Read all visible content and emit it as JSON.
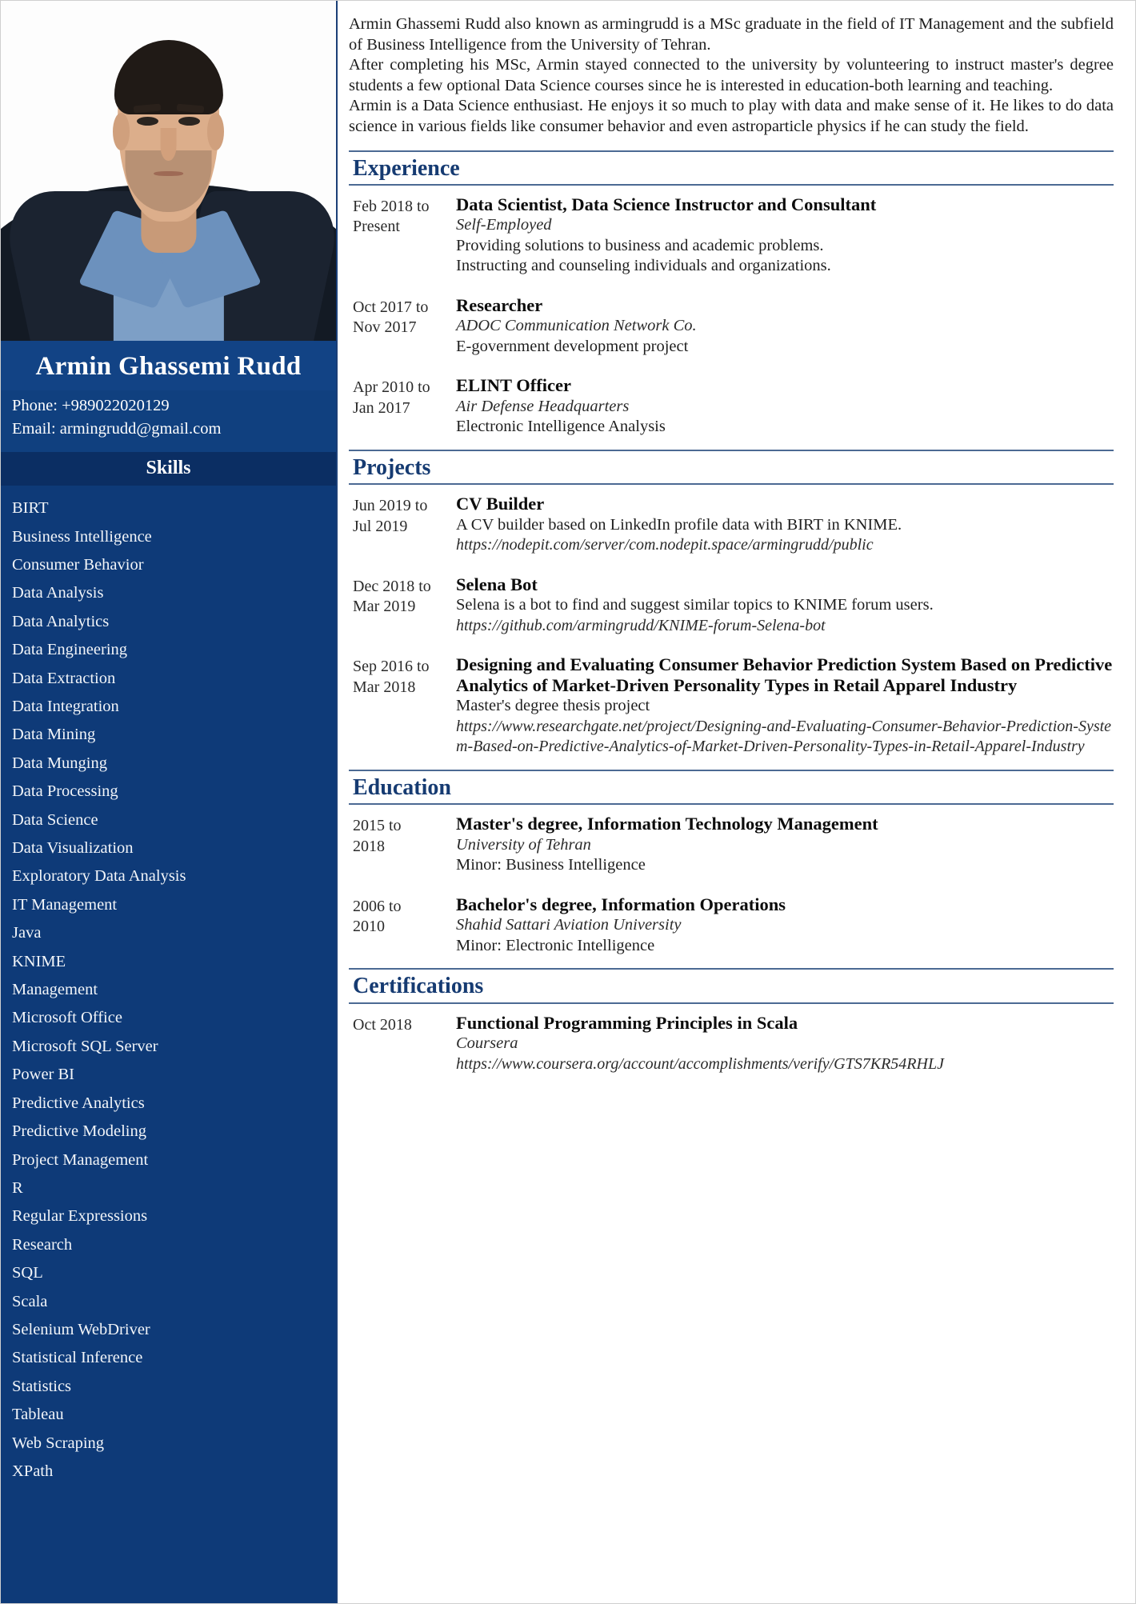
{
  "sidebar": {
    "photo_alt": "portrait-photo",
    "name": "Armin Ghassemi Rudd",
    "contact": {
      "phone": "Phone: +989022020129",
      "email": "Email: armingrudd@gmail.com"
    },
    "skills_heading": "Skills",
    "skills": [
      "BIRT",
      "Business Intelligence",
      "Consumer Behavior",
      "Data Analysis",
      "Data Analytics",
      "Data Engineering",
      "Data Extraction",
      "Data Integration",
      "Data Mining",
      "Data Munging",
      "Data Processing",
      "Data Science",
      "Data Visualization",
      "Exploratory Data Analysis",
      "IT Management",
      "Java",
      "KNIME",
      "Management",
      "Microsoft Office",
      "Microsoft SQL Server",
      "Power BI",
      "Predictive Analytics",
      "Predictive Modeling",
      "Project Management",
      "R",
      "Regular Expressions",
      "Research",
      "SQL",
      "Scala",
      "Selenium WebDriver",
      "Statistical Inference",
      "Statistics",
      "Tableau",
      "Web Scraping",
      "XPath"
    ]
  },
  "summary": {
    "paragraph_1": "Armin Ghassemi Rudd also known as armingrudd is a MSc graduate in the field of IT Management and the subfield of Business Intelligence from the University of Tehran.",
    "paragraph_2": "After completing his MSc, Armin stayed connected to the university by volunteering to instruct master's degree students a few optional Data Science courses since he is interested in education-both learning and teaching.",
    "paragraph_3": "Armin is a Data Science enthusiast. He enjoys it so much to play with data and make sense of it. He likes to do data science in various fields like consumer behavior and even astroparticle physics if he can study the field."
  },
  "sections": [
    {
      "id": "experience",
      "heading": "Experience",
      "entries": [
        {
          "date_from": "Feb 2018 to",
          "date_to": "Present",
          "title": "Data Scientist, Data Science Instructor and Consultant",
          "subtitle": "Self-Employed",
          "lines": [
            "Providing solutions to business and academic problems.",
            "Instructing and counseling individuals and organizations."
          ],
          "url": ""
        },
        {
          "date_from": "Oct 2017 to",
          "date_to": "Nov 2017",
          "title": "Researcher",
          "subtitle": "ADOC Communication Network Co.",
          "lines": [
            "E-government development project"
          ],
          "url": ""
        },
        {
          "date_from": "Apr 2010 to",
          "date_to": "Jan 2017",
          "title": "ELINT Officer",
          "subtitle": "Air Defense Headquarters",
          "lines": [
            "Electronic Intelligence Analysis"
          ],
          "url": ""
        }
      ]
    },
    {
      "id": "projects",
      "heading": "Projects",
      "entries": [
        {
          "date_from": "Jun 2019 to",
          "date_to": "Jul 2019",
          "title": "CV Builder",
          "subtitle": "",
          "lines": [
            "A CV builder based on LinkedIn profile data with BIRT in KNIME."
          ],
          "url": "https://nodepit.com/server/com.nodepit.space/armingrudd/public"
        },
        {
          "date_from": "Dec 2018 to",
          "date_to": "Mar 2019",
          "title": "Selena Bot",
          "subtitle": "",
          "lines": [
            "Selena is a bot to find and suggest similar topics to KNIME forum users."
          ],
          "url": "https://github.com/armingrudd/KNIME-forum-Selena-bot"
        },
        {
          "date_from": "Sep 2016 to",
          "date_to": "Mar 2018",
          "title": "Designing and Evaluating Consumer Behavior Prediction System Based on Predictive Analytics of Market-Driven Personality Types in Retail Apparel Industry",
          "subtitle": "",
          "lines": [
            "Master's degree thesis project"
          ],
          "url": "https://www.researchgate.net/project/Designing-and-Evaluating-Consumer-Behavior-Prediction-System-Based-on-Predictive-Analytics-of-Market-Driven-Personality-Types-in-Retail-Apparel-Industry"
        }
      ]
    },
    {
      "id": "education",
      "heading": "Education",
      "entries": [
        {
          "date_from": "2015 to",
          "date_to": "2018",
          "title": "Master's degree, Information Technology Management",
          "subtitle": "University of Tehran",
          "lines": [
            "Minor: Business Intelligence"
          ],
          "url": ""
        },
        {
          "date_from": "2006 to",
          "date_to": "2010",
          "title": "Bachelor's degree, Information Operations",
          "subtitle": "Shahid Sattari Aviation University",
          "lines": [
            "Minor: Electronic Intelligence"
          ],
          "url": ""
        }
      ]
    },
    {
      "id": "certifications",
      "heading": "Certifications",
      "entries": [
        {
          "date_from": "Oct 2018",
          "date_to": "",
          "title": "Functional Programming Principles in Scala",
          "subtitle": "Coursera",
          "lines": [],
          "url": "https://www.coursera.org/account/accomplishments/verify/GTS7KR54RHLJ"
        }
      ]
    }
  ],
  "colors": {
    "sidebar_bg": "#0e3a78",
    "name_band_bg": "#124385",
    "skills_head_bg": "#0b2e63",
    "section_heading": "#163b72",
    "rule": "#4c6a93"
  }
}
